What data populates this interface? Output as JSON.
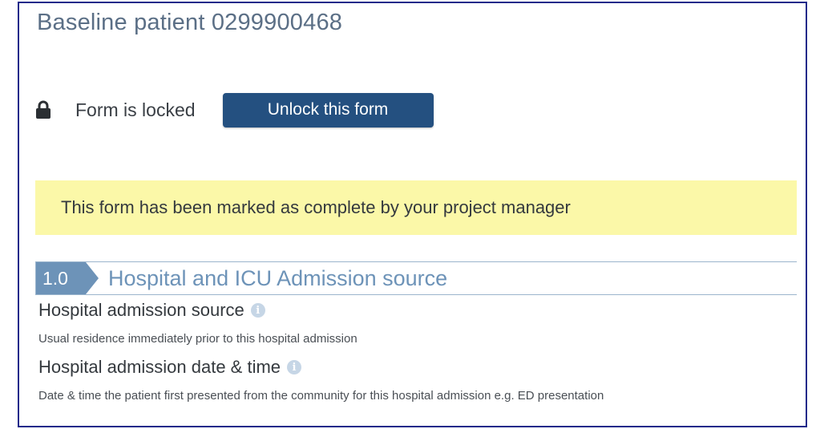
{
  "form": {
    "title": "Baseline patient 0299900468",
    "lock_status": "Form is locked",
    "unlock_button_label": "Unlock this form",
    "notice": "This form has been marked as complete by your project manager"
  },
  "section": {
    "number": "1.0",
    "title": "Hospital and ICU Admission source"
  },
  "fields": [
    {
      "label": "Hospital admission source",
      "help": "Usual residence immediately prior to this hospital admission"
    },
    {
      "label": "Hospital admission date & time",
      "help": "Date & time the patient first presented from the community for this hospital admission e.g. ED presentation"
    }
  ],
  "icons": {
    "lock": "lock-icon",
    "info": "info-icon",
    "info_glyph": "i"
  },
  "colors": {
    "button": "#245080",
    "notice_background": "#fbf8a8",
    "section_accent": "#6d93b8",
    "title_text": "#5b6f86",
    "frame_border": "#1f2a8a"
  }
}
